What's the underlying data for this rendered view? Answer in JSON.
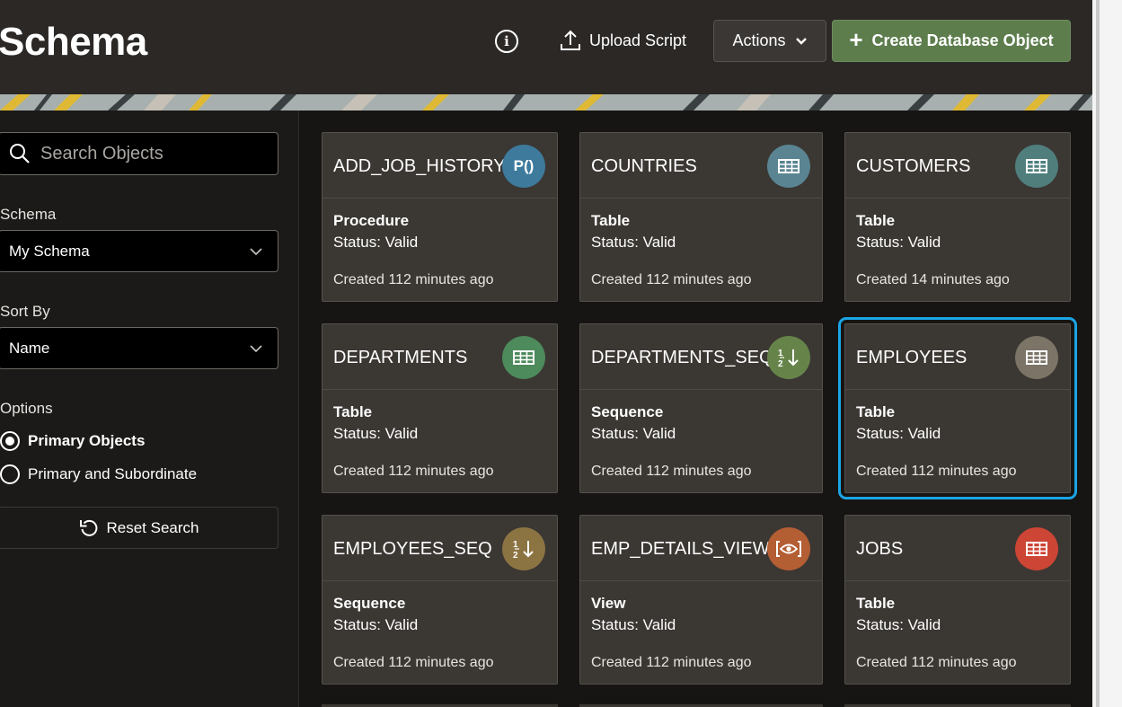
{
  "header": {
    "title": "Schema",
    "upload_label": "Upload Script",
    "actions_label": "Actions",
    "create_label": "Create Database Object"
  },
  "sidebar": {
    "search_placeholder": "Search Objects",
    "schema_label": "Schema",
    "schema_value": "My Schema",
    "sort_label": "Sort By",
    "sort_value": "Name",
    "options_label": "Options",
    "option_primary": "Primary Objects",
    "option_subordinate": "Primary and Subordinate",
    "selected_option": "Primary Objects",
    "reset_label": "Reset Search"
  },
  "cards": [
    {
      "name": "ADD_JOB_HISTORY",
      "type": "Procedure",
      "status": "Status: Valid",
      "created": "Created 112 minutes ago",
      "icon": "procedure-icon",
      "icon_text": "P()",
      "color": "#3d7a9c"
    },
    {
      "name": "COUNTRIES",
      "type": "Table",
      "status": "Status: Valid",
      "created": "Created 112 minutes ago",
      "icon": "table-icon",
      "color": "#5a8492"
    },
    {
      "name": "CUSTOMERS",
      "type": "Table",
      "status": "Status: Valid",
      "created": "Created 14 minutes ago",
      "icon": "table-icon",
      "color": "#4f7e7d"
    },
    {
      "name": "DEPARTMENTS",
      "type": "Table",
      "status": "Status: Valid",
      "created": "Created 112 minutes ago",
      "icon": "table-icon",
      "color": "#4d8a5c"
    },
    {
      "name": "DEPARTMENTS_SEQ",
      "type": "Sequence",
      "status": "Status: Valid",
      "created": "Created 112 minutes ago",
      "icon": "sequence-icon",
      "color": "#66844a"
    },
    {
      "name": "EMPLOYEES",
      "type": "Table",
      "status": "Status: Valid",
      "created": "Created 112 minutes ago",
      "icon": "table-icon",
      "color": "#7b7467",
      "selected": true
    },
    {
      "name": "EMPLOYEES_SEQ",
      "type": "Sequence",
      "status": "Status: Valid",
      "created": "Created 112 minutes ago",
      "icon": "sequence-icon",
      "color": "#8c7442"
    },
    {
      "name": "EMP_DETAILS_VIEW",
      "type": "View",
      "status": "Status: Valid",
      "created": "Created 112 minutes ago",
      "icon": "view-icon",
      "color": "#b45e34"
    },
    {
      "name": "JOBS",
      "type": "Table",
      "status": "Status: Valid",
      "created": "Created 112 minutes ago",
      "icon": "table-icon",
      "color": "#cc4535"
    }
  ]
}
